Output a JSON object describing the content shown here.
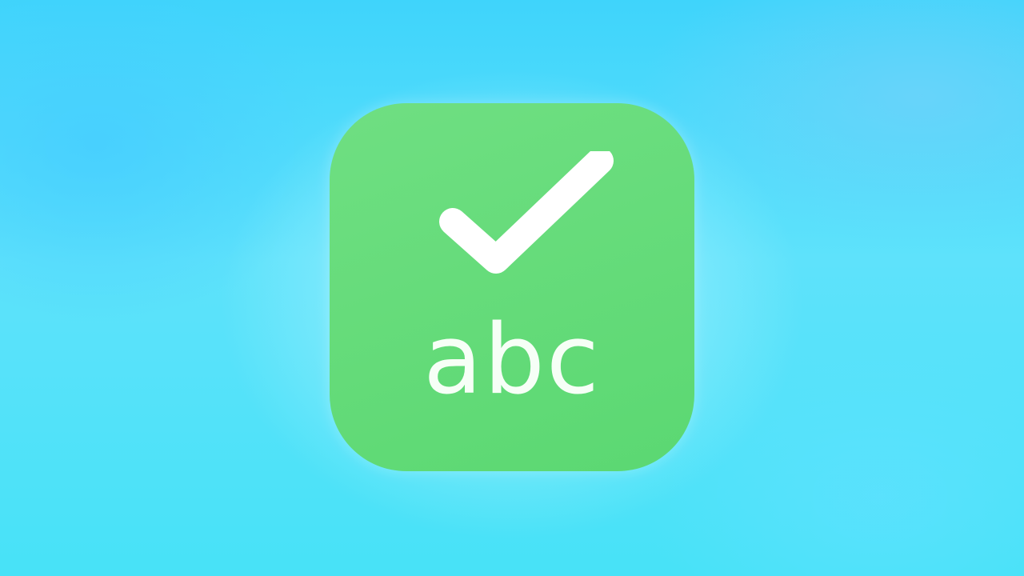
{
  "app_icon": {
    "name": "grammar-checker-app-icon",
    "text": "abc",
    "symbol": "checkmark-icon",
    "background_color": "#5fda75",
    "foreground_color": "#ffffff"
  },
  "background": {
    "color": "#4fdcfa"
  }
}
